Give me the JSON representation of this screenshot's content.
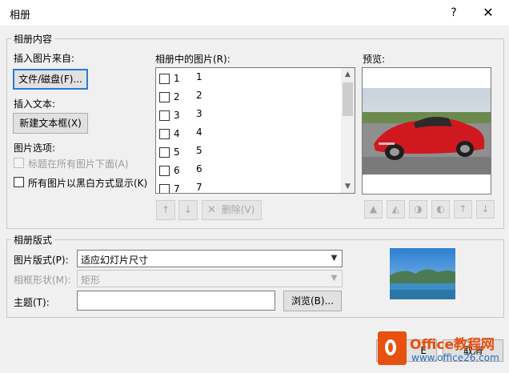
{
  "window": {
    "title": "相册",
    "help_glyph": "?",
    "close_glyph": "✕"
  },
  "content_group": {
    "label": "相册内容",
    "insert_from_label": "插入图片来自:",
    "file_button": "文件/磁盘(F)...",
    "insert_text_label": "插入文本:",
    "new_textbox_button": "新建文本框(X)",
    "picture_options_label": "图片选项:",
    "caption_option": "标题在所有图片下面(A)",
    "bw_option": "所有图片以黑白方式显示(K)"
  },
  "pictures": {
    "label": "相册中的图片(R):",
    "items": [
      {
        "index": "1",
        "name": "1"
      },
      {
        "index": "2",
        "name": "2"
      },
      {
        "index": "3",
        "name": "3"
      },
      {
        "index": "4",
        "name": "4"
      },
      {
        "index": "5",
        "name": "5"
      },
      {
        "index": "6",
        "name": "6"
      },
      {
        "index": "7",
        "name": "7"
      }
    ],
    "move_up_glyph": "↑",
    "move_down_glyph": "↓",
    "delete_button": "删除(V)"
  },
  "preview": {
    "label": "预览:",
    "tools": [
      "rotate-left-icon",
      "rotate-right-icon",
      "contrast-up-icon",
      "contrast-down-icon",
      "brightness-up-icon",
      "brightness-down-icon"
    ]
  },
  "layout_group": {
    "label": "相册版式",
    "picture_layout_label": "图片版式(P):",
    "picture_layout_value": "适应幻灯片尺寸",
    "frame_shape_label": "相框形状(M):",
    "frame_shape_value": "矩形",
    "theme_label": "主题(T):",
    "theme_value": "",
    "browse_button": "浏览(B)..."
  },
  "footer": {
    "create_button_partial": "E",
    "cancel_button": "取消"
  },
  "watermark": {
    "brand": "Office教程网",
    "url": "www.office26.com"
  },
  "colors": {
    "accent": "#2a7ad8",
    "watermark_orange": "#e8500f"
  }
}
